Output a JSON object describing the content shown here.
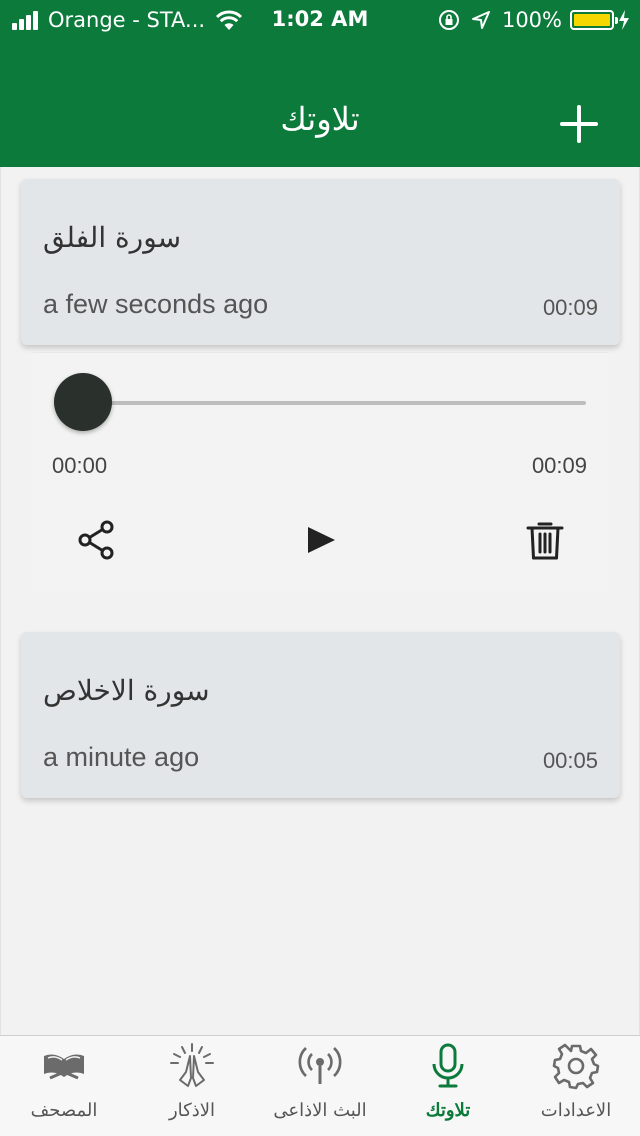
{
  "colors": {
    "primary": "#0b7a3b",
    "card_bg": "#e3e6e8",
    "battery": "#f6d800",
    "slider_thumb": "#2a312c"
  },
  "status_bar": {
    "carrier": "Orange - STA...",
    "time": "1:02 AM",
    "battery_percent": "100%",
    "signal_icon": "signal-bars-icon",
    "wifi_icon": "wifi-icon",
    "lock_icon": "orientation-lock-icon",
    "location_icon": "location-arrow-icon",
    "battery_icon": "battery-icon",
    "charging_icon": "charging-bolt-icon",
    "signal_bars": 4
  },
  "header": {
    "title": "تلاوتك",
    "add_icon": "plus-icon"
  },
  "recordings": [
    {
      "title": "سورة الفلق",
      "time_ago": "a few seconds ago",
      "duration": "00:09"
    },
    {
      "title": "سورة الاخلاص",
      "time_ago": "a minute ago",
      "duration": "00:05"
    }
  ],
  "player": {
    "current_time": "00:00",
    "total_time": "00:09",
    "progress": 0,
    "share_icon": "share-icon",
    "play_icon": "play-icon",
    "delete_icon": "trash-icon"
  },
  "tabs": [
    {
      "label": "المصحف",
      "icon": "quran-book-icon",
      "active": false
    },
    {
      "label": "الاذكار",
      "icon": "praying-hands-icon",
      "active": false
    },
    {
      "label": "البث الاذاعى",
      "icon": "radio-broadcast-icon",
      "active": false
    },
    {
      "label": "تلاوتك",
      "icon": "microphone-icon",
      "active": true
    },
    {
      "label": "الاعدادات",
      "icon": "settings-gear-icon",
      "active": false
    }
  ]
}
